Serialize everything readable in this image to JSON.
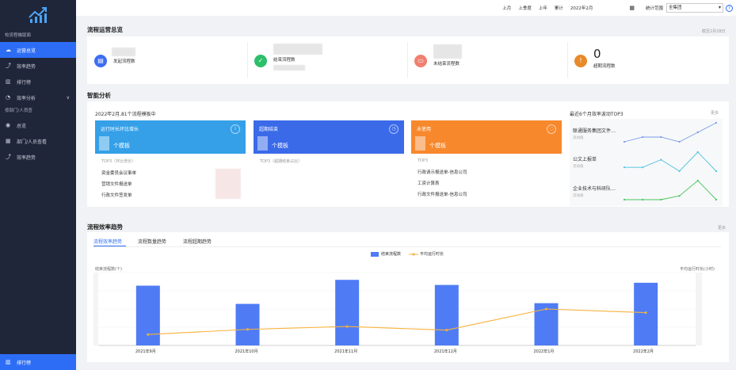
{
  "sidebar": {
    "section1": "校流程機版面",
    "items": [
      {
        "label": "运营总览",
        "active": true
      },
      {
        "label": "效率趋势"
      },
      {
        "label": "排行榜"
      },
      {
        "label": "效率分析",
        "arrow": "∨"
      }
    ],
    "section2": "按部门/人员查",
    "items2": [
      {
        "label": "总览"
      },
      {
        "label": "部门/人员查看"
      },
      {
        "label": "效率趋势"
      }
    ],
    "bottom": "排行榜"
  },
  "topbar": {
    "links": [
      "上月",
      "上季度",
      "上年",
      "累计"
    ],
    "date": "2022年2月",
    "scope_label": "统计范围",
    "scope_value": "全集团",
    "help": "?"
  },
  "overview": {
    "title": "流程运营总览",
    "note": "截至2月28日",
    "stats": [
      {
        "label": "发起流程数",
        "color": "#3d6df2",
        "icon": "▤"
      },
      {
        "label": "结束流程数",
        "color": "#2dbf6a",
        "icon": "✓"
      },
      {
        "label": "未结束流程数",
        "color": "#f08070",
        "icon": "▭"
      },
      {
        "label": "超期流程数",
        "value": "0",
        "color": "#e88a2a",
        "icon": "!"
      }
    ]
  },
  "smart": {
    "title": "智能分析",
    "subtitle": "2022年2月,81个流程模板中",
    "tiles": [
      {
        "title": "运行时长环比增长",
        "unit": "个模板",
        "color": "#35a0e8",
        "icon": "i",
        "top3": "TOP3（环比增长）",
        "items": [
          "资金委员会议事单",
          "营销文件报送单",
          "行政文件签发单"
        ]
      },
      {
        "title": "超期结束",
        "unit": "个模板",
        "color": "#3a6ae8",
        "icon": "◷",
        "top3": "TOP3（超期结束占比）",
        "items": []
      },
      {
        "title": "未使用",
        "unit": "个模板",
        "color": "#f7882c",
        "icon": "◌",
        "top3": "TOP3",
        "items": [
          "行政请示报送单-信息公司",
          "工资计算表",
          "行政文件报送单-信息公司"
        ]
      }
    ],
    "right_title": "最近6个月效率波动TOP3",
    "more": "更多",
    "minis": [
      {
        "name": "联通服务集团文件…",
        "sub": "流动值",
        "color": "#7a9be8",
        "values": [
          4,
          5,
          5,
          4,
          6,
          8
        ]
      },
      {
        "name": "公文上报单",
        "sub": "流动值",
        "color": "#4ec3de",
        "values": [
          2,
          2,
          4,
          1,
          6,
          1
        ]
      },
      {
        "name": "企业技术与科研队…",
        "sub": "流动值",
        "color": "#49c45a",
        "values": [
          2,
          2,
          2,
          3,
          7,
          2
        ]
      }
    ]
  },
  "trend": {
    "title": "流程效率趋势",
    "more": "更多",
    "tabs": [
      "流程效率趋势",
      "流程数量趋势",
      "流程超期趋势"
    ]
  },
  "chart_data": {
    "type": "bar",
    "categories": [
      "2021年9月",
      "2021年10月",
      "2021年11月",
      "2021年12月",
      "2022年1月",
      "2022年2月"
    ],
    "series": [
      {
        "name": "结束流程数",
        "type": "bar",
        "color": "#4f7cf5",
        "values": [
          82,
          57,
          90,
          83,
          58,
          86
        ]
      },
      {
        "name": "平均运行时长",
        "type": "line",
        "color": "#f7b13a",
        "values": [
          15,
          22,
          26,
          21,
          50,
          45
        ]
      }
    ],
    "ylabel": "结束流程数(个)",
    "ylabel_right": "平均运行时长(小时)",
    "ylim": [
      0,
      100
    ],
    "legend": "top"
  }
}
